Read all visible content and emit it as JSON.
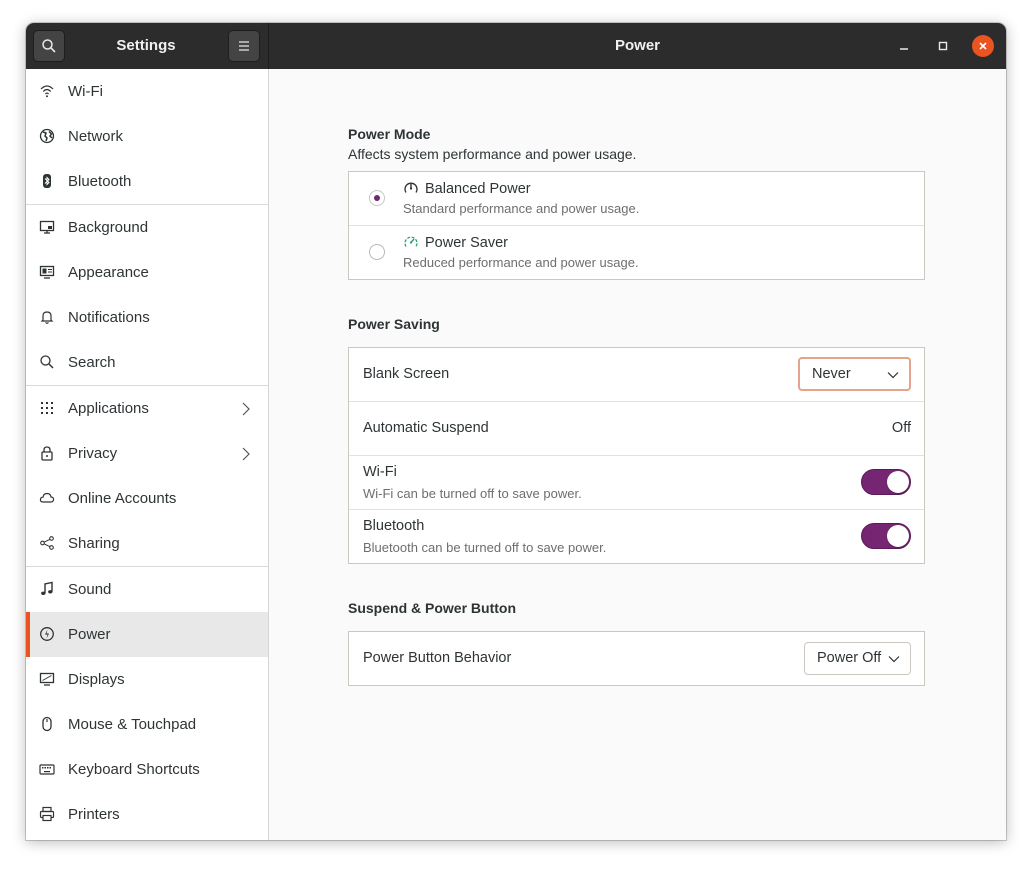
{
  "window": {
    "app_title": "Settings",
    "page_title": "Power"
  },
  "header": {
    "search_icon": "search-icon",
    "menu_icon": "hamburger-menu-icon",
    "minimize_icon": "minimize-icon",
    "maximize_icon": "maximize-icon",
    "close_icon": "close-icon"
  },
  "sidebar": {
    "items": [
      {
        "label": "Wi-Fi",
        "icon": "wifi-icon"
      },
      {
        "label": "Network",
        "icon": "network-globe-icon"
      },
      {
        "label": "Bluetooth",
        "icon": "bluetooth-icon"
      },
      {
        "label": "Background",
        "icon": "background-icon"
      },
      {
        "label": "Appearance",
        "icon": "appearance-icon"
      },
      {
        "label": "Notifications",
        "icon": "bell-icon"
      },
      {
        "label": "Search",
        "icon": "search-icon"
      },
      {
        "label": "Applications",
        "icon": "grid-icon"
      },
      {
        "label": "Privacy",
        "icon": "lock-icon"
      },
      {
        "label": "Online Accounts",
        "icon": "cloud-icon"
      },
      {
        "label": "Sharing",
        "icon": "share-icon"
      },
      {
        "label": "Sound",
        "icon": "music-note-icon"
      },
      {
        "label": "Power",
        "icon": "power-icon"
      },
      {
        "label": "Displays",
        "icon": "display-icon"
      },
      {
        "label": "Mouse & Touchpad",
        "icon": "mouse-icon"
      },
      {
        "label": "Keyboard Shortcuts",
        "icon": "keyboard-icon"
      },
      {
        "label": "Printers",
        "icon": "printer-icon"
      }
    ],
    "active": "Power"
  },
  "power_mode": {
    "title": "Power Mode",
    "subtitle": "Affects system performance and power usage.",
    "options": [
      {
        "title": "Balanced Power",
        "description": "Standard performance and power usage.",
        "selected": true,
        "icon": "speedometer-icon"
      },
      {
        "title": "Power Saver",
        "description": "Reduced performance and power usage.",
        "selected": false,
        "icon": "leaf-gauge-icon"
      }
    ]
  },
  "power_saving": {
    "title": "Power Saving",
    "blank_screen": {
      "label": "Blank Screen",
      "value": "Never"
    },
    "automatic_suspend": {
      "label": "Automatic Suspend",
      "value": "Off"
    },
    "wifi": {
      "label": "Wi-Fi",
      "description": "Wi-Fi can be turned off to save power.",
      "enabled": true
    },
    "bluetooth": {
      "label": "Bluetooth",
      "description": "Bluetooth can be turned off to save power.",
      "enabled": true
    }
  },
  "suspend_power_button": {
    "title": "Suspend & Power Button",
    "power_button_behavior": {
      "label": "Power Button Behavior",
      "value": "Power Off"
    }
  },
  "colors": {
    "accent": "#e95420",
    "switch_on": "#762572",
    "headerbar": "#2c2c2c"
  }
}
